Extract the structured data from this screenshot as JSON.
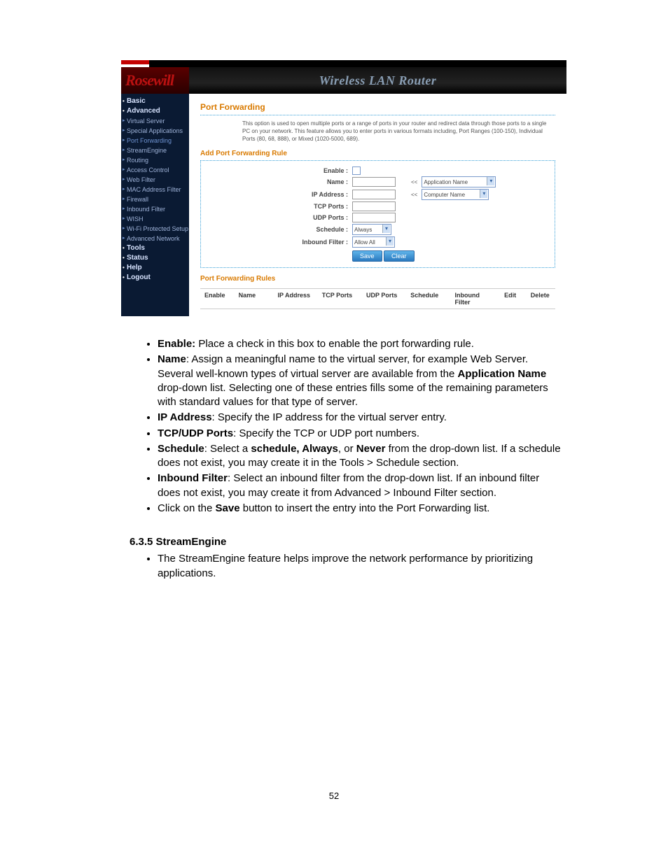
{
  "brand": "Rosewill",
  "header_title": "Wireless LAN Router",
  "sidebar": {
    "items": [
      {
        "label": "Basic",
        "cat": true
      },
      {
        "label": "Advanced",
        "cat": true
      },
      {
        "label": "Virtual Server"
      },
      {
        "label": "Special Applications"
      },
      {
        "label": "Port Forwarding",
        "sel": true
      },
      {
        "label": "StreamEngine"
      },
      {
        "label": "Routing"
      },
      {
        "label": "Access Control"
      },
      {
        "label": "Web Filter"
      },
      {
        "label": "MAC Address Filter"
      },
      {
        "label": "Firewall"
      },
      {
        "label": "Inbound Filter"
      },
      {
        "label": "WISH"
      },
      {
        "label": "Wi-Fi Protected Setup"
      },
      {
        "label": "Advanced Network"
      },
      {
        "label": "Tools",
        "cat": true
      },
      {
        "label": "Status",
        "cat": true
      },
      {
        "label": "Help",
        "cat": true
      },
      {
        "label": "Logout",
        "cat": true
      }
    ]
  },
  "main": {
    "title": "Port Forwarding",
    "desc": "This option is used to open multiple ports or a range of ports in your router and redirect data through those ports to a single PC on your network. This feature allows you to enter ports in various formats including, Port Ranges (100-150), Individual Ports (80, 68, 888), or Mixed (1020-5000, 689).",
    "sub_title": "Add Port Forwarding Rule",
    "form": {
      "enable": "Enable :",
      "name": "Name :",
      "ip": "IP Address :",
      "tcp": "TCP Ports :",
      "udp": "UDP Ports :",
      "sched": "Schedule :",
      "inbound": "Inbound Filter :",
      "app_name": "Application Name",
      "computer_name": "Computer Name",
      "always": "Always",
      "allow_all": "Allow All",
      "arrows": "<<",
      "save": "Save",
      "clear": "Clear"
    },
    "rules_title": "Port Forwarding Rules",
    "rules_headers": {
      "enable": "Enable",
      "name": "Name",
      "ip": "IP Address",
      "tcp": "TCP Ports",
      "udp": "UDP Ports",
      "sched": "Schedule",
      "inbound": "Inbound Filter",
      "edit": "Edit",
      "del": "Delete"
    }
  },
  "doc": {
    "b_enable": "Enable:",
    "t_enable": " Place a check in this box to enable the port forwarding rule.",
    "b_name": "Name",
    "t_name_1": ": Assign a meaningful name to the virtual server, for example Web Server. Several well-known types of virtual server are available from the ",
    "b_appname": "Application Name",
    "t_name_2": " drop-down list. Selecting one of these entries fills some of the remaining parameters with standard values for that type of server.",
    "b_ip": "IP Address",
    "t_ip": ": Specify the IP address for the virtual server entry.",
    "b_ports": "TCP/UDP Ports",
    "t_ports": ": Specify the TCP or UDP port numbers.",
    "b_sched": "Schedule",
    "t_sched_1": ": Select a ",
    "b_sched2": "schedule, Always",
    "t_sched_2": ", or ",
    "b_never": "Never",
    "t_sched_3": " from the drop-down list. If a schedule does not exist, you may create it in the Tools > Schedule section.",
    "b_inbound": "Inbound Filter",
    "t_inbound": ": Select an inbound filter from the drop-down list. If an inbound filter does not exist, you may create it from Advanced > Inbound Filter section.",
    "t_save_1": "Click on the ",
    "b_save": "Save",
    "t_save_2": " button to insert the entry into the Port Forwarding list.",
    "sec_h": "6.3.5  StreamEngine",
    "t_stream": "The StreamEngine feature helps improve the network performance by prioritizing applications."
  },
  "page_number": "52"
}
